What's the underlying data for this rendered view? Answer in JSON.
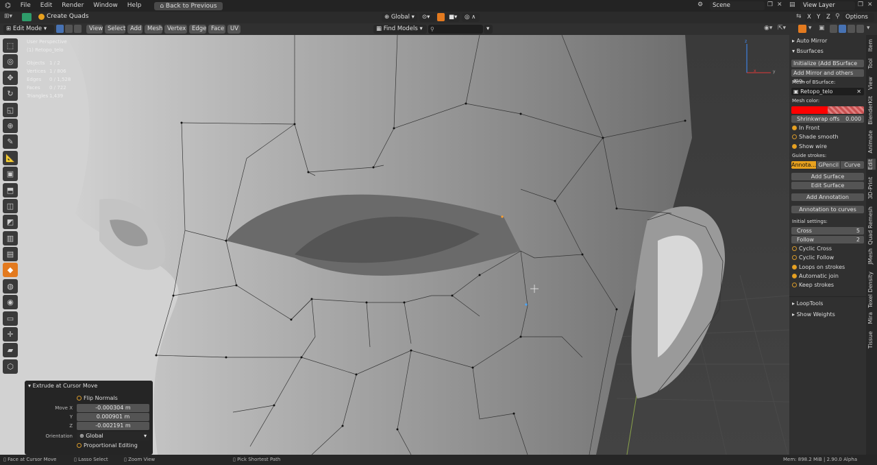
{
  "menubar": {
    "items": [
      "File",
      "Edit",
      "Render",
      "Window",
      "Help"
    ],
    "back_button": "Back to Previous",
    "scene": "Scene",
    "view_layer": "View Layer"
  },
  "header": {
    "operator": "Create Quads",
    "orientation": "Global",
    "options": "Options",
    "xyz": [
      "X",
      "Y",
      "Z"
    ]
  },
  "header2": {
    "mode": "Edit Mode",
    "menus": [
      "View",
      "Select",
      "Add",
      "Mesh",
      "Vertex",
      "Edge",
      "Face",
      "UV"
    ],
    "find_models": "Find Models"
  },
  "overlay": {
    "perspective": "User Perspective",
    "object": "(1) Retopo_telo",
    "stats": [
      {
        "label": "Objects",
        "value": "1 / 2"
      },
      {
        "label": "Vertices",
        "value": "1 / 806"
      },
      {
        "label": "Edges",
        "value": "0 / 1,528"
      },
      {
        "label": "Faces",
        "value": "0 / 722"
      },
      {
        "label": "Triangles",
        "value": "1,439"
      }
    ]
  },
  "operator_panel": {
    "title": "Extrude at Cursor Move",
    "flip_normals": "Flip Normals",
    "move_x_label": "Move X",
    "move_x": "-0.000304 m",
    "y_label": "Y",
    "y": "0.000901 m",
    "z_label": "Z",
    "z": "-0.002191 m",
    "orientation_label": "Orientation",
    "orientation": "Global",
    "proportional": "Proportional Editing"
  },
  "npanel": {
    "auto_mirror": "Auto Mirror",
    "bsurfaces": "Bsurfaces",
    "initialize": "Initialize (Add BSurface m...",
    "add_mirror": "Add Mirror and others mo...",
    "mesh_of_bsurface": "Mesh of BSurface:",
    "mesh_name": "Retopo_telo",
    "mesh_color": "Mesh color:",
    "shrinkwrap": "Shrinkwrap offs",
    "shrinkwrap_value": "0.000",
    "in_front": "In Front",
    "shade_smooth": "Shade smooth",
    "show_wire": "Show wire",
    "guide_strokes": "Guide strokes:",
    "tabs": [
      "Annota...",
      "GPencil",
      "Curve"
    ],
    "add_surface": "Add Surface",
    "edit_surface": "Edit Surface",
    "add_annotation": "Add Annotation",
    "annotation_to_curves": "Annotation to curves",
    "initial_settings": "Initial settings:",
    "cross_label": "Cross",
    "cross_value": "5",
    "follow_label": "Follow",
    "follow_value": "2",
    "cyclic_cross": "Cyclic Cross",
    "cyclic_follow": "Cyclic Follow",
    "loops_on_strokes": "Loops on strokes",
    "automatic_join": "Automatic join",
    "keep_strokes": "Keep strokes",
    "looptools": "LoopTools",
    "show_weights": "Show Weights"
  },
  "vtabs": [
    "Item",
    "Tool",
    "View",
    "BlenderKit",
    "Animate",
    "Edit",
    "3D-Print",
    "Quad Remesh",
    "JMesh",
    "Texel Density",
    "Mira",
    "Tissue"
  ],
  "statusbar": {
    "left1": "Face at Cursor Move",
    "left2": "Lasso Select",
    "left3": "Zoom View",
    "mid": "Pick Shortest Path",
    "right": "Mem: 898.2 MiB | 2.90.0 Alpha"
  },
  "colors": {
    "accent": "#e37a1f",
    "mesh_color": "#ff0000",
    "radio": "#e8a11e"
  }
}
